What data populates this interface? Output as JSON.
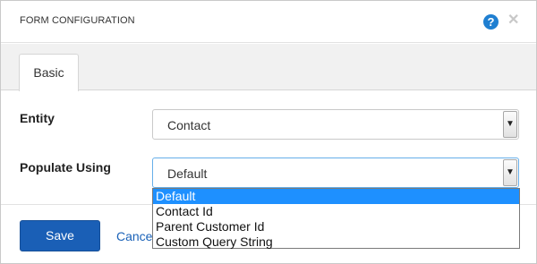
{
  "dialog": {
    "title": "FORM CONFIGURATION",
    "help_icon": "help-icon",
    "help_glyph": "?",
    "close_icon": "close-icon",
    "close_glyph": "✕"
  },
  "tabs": [
    {
      "label": "Basic",
      "active": true
    }
  ],
  "fields": {
    "entity": {
      "label": "Entity",
      "value": "Contact"
    },
    "populate_using": {
      "label": "Populate Using",
      "value": "Default",
      "options": [
        "Default",
        "Contact Id",
        "Parent Customer Id",
        "Custom Query String"
      ],
      "highlighted_option": "Default"
    }
  },
  "footer": {
    "save_label": "Save",
    "cancel_label": "Cancel"
  },
  "colors": {
    "accent": "#1f7fd1",
    "save_button": "#1a5fb6",
    "option_highlight": "#1e90ff",
    "cancel_link": "#1a62b8"
  }
}
